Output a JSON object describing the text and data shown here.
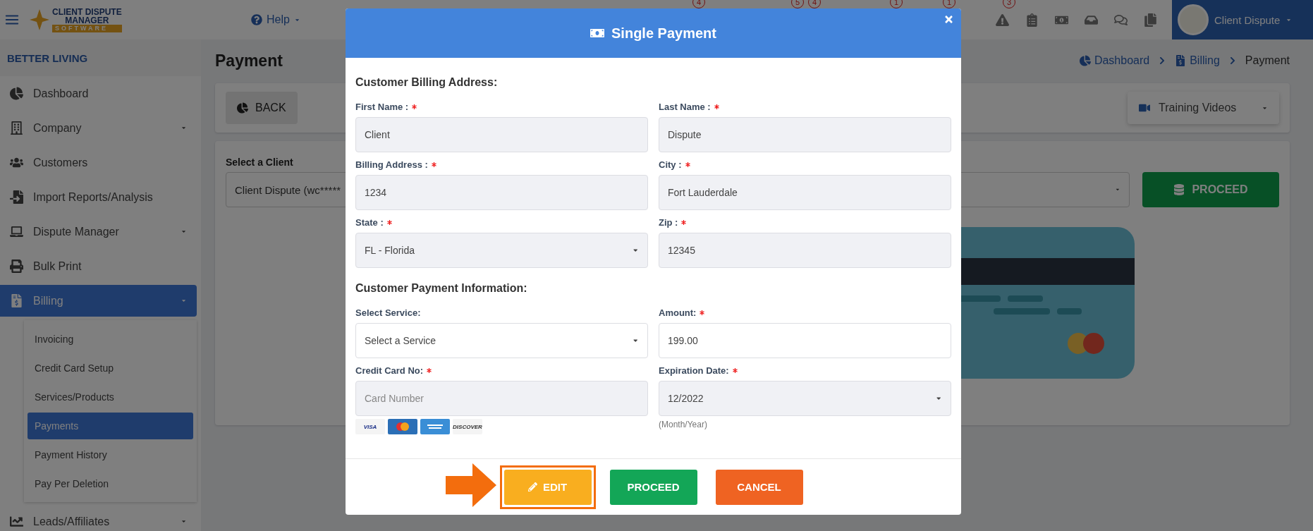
{
  "topbar": {
    "logo": {
      "line1": "CLIENT DISPUTE",
      "line2": "MANAGER",
      "line3": "SOFTWARE"
    },
    "help": "Help",
    "badges_hidden": [
      {
        "badge": "4"
      },
      {
        "badge": "5"
      },
      {
        "badge": "4"
      },
      {
        "badge": "1"
      },
      {
        "badge": "1"
      }
    ],
    "icons": [
      {
        "kind": "warning",
        "badge": "3"
      },
      {
        "kind": "clipboard"
      },
      {
        "kind": "money"
      },
      {
        "kind": "inbox"
      },
      {
        "kind": "comments"
      },
      {
        "kind": "copy"
      }
    ],
    "user": "Client Dispute"
  },
  "sidebar": {
    "company": "BETTER LIVING",
    "items": [
      {
        "label": "Dashboard",
        "kind": "dashboard",
        "selected": false,
        "has_submenu": false
      },
      {
        "label": "Company",
        "kind": "company",
        "selected": false,
        "has_submenu": true
      },
      {
        "label": "Customers",
        "kind": "customers",
        "selected": false,
        "has_submenu": false
      },
      {
        "label": "Import Reports/Analysis",
        "kind": "import",
        "selected": false,
        "has_submenu": false
      },
      {
        "label": "Dispute Manager",
        "kind": "laptop",
        "selected": false,
        "has_submenu": true
      },
      {
        "label": "Bulk Print",
        "kind": "print",
        "selected": false,
        "has_submenu": false
      },
      {
        "label": "Billing",
        "kind": "billing",
        "selected": true,
        "has_submenu": true,
        "children": [
          {
            "label": "Invoicing",
            "selected": false
          },
          {
            "label": "Credit Card Setup",
            "selected": false
          },
          {
            "label": "Services/Products",
            "selected": false
          },
          {
            "label": "Payments",
            "selected": true
          },
          {
            "label": "Payment History",
            "selected": false
          },
          {
            "label": "Pay Per Deletion",
            "selected": false
          }
        ]
      },
      {
        "label": "Leads/Affiliates",
        "kind": "leads",
        "selected": false,
        "has_submenu": true
      }
    ]
  },
  "page": {
    "title": "Payment",
    "breadcrumb": [
      {
        "label": "Dashboard",
        "kind": "dashboard"
      },
      {
        "label": "Billing",
        "kind": "billing"
      },
      {
        "label": "Payment",
        "kind": "current"
      }
    ],
    "back": "BACK",
    "training": "Training Videos",
    "client_label": "Select a Client",
    "client_value": "Client Dispute (wc*****",
    "proceed": "PROCEED"
  },
  "modal": {
    "title": "Single Payment",
    "sections": [
      {
        "title": "Customer Billing Address:",
        "fields": [
          {
            "label": "First Name :",
            "required": true,
            "kind": "input",
            "readonly": true,
            "value": "Client"
          },
          {
            "label": "Last Name :",
            "required": true,
            "kind": "input",
            "readonly": true,
            "value": "Dispute"
          },
          {
            "label": "Billing Address :",
            "required": true,
            "kind": "input",
            "readonly": true,
            "value": "1234"
          },
          {
            "label": "City :",
            "required": true,
            "kind": "input",
            "readonly": true,
            "value": "Fort Lauderdale"
          },
          {
            "label": "State :",
            "required": true,
            "kind": "select",
            "readonly": true,
            "value": "FL - Florida"
          },
          {
            "label": "Zip :",
            "required": true,
            "kind": "input",
            "readonly": true,
            "value": "12345"
          }
        ]
      },
      {
        "title": "Customer Payment Information:",
        "fields": [
          {
            "label": "Select Service:",
            "required": false,
            "kind": "select",
            "readonly": false,
            "value": "Select a Service"
          },
          {
            "label": "Amount:",
            "required": true,
            "kind": "input",
            "readonly": false,
            "value": "199.00"
          },
          {
            "label": "Credit Card No:",
            "required": true,
            "kind": "input",
            "readonly": true,
            "placeholder": "Card Number",
            "brands": [
              {
                "kind": "visa",
                "text": "VISA"
              },
              {
                "kind": "mastercard"
              },
              {
                "kind": "amex"
              },
              {
                "kind": "discover",
                "text": "DISCOVER"
              }
            ]
          },
          {
            "label": "Expiration Date:",
            "required": true,
            "kind": "select",
            "readonly": true,
            "value": "12/2022",
            "hint": "(Month/Year)"
          }
        ]
      }
    ],
    "buttons": [
      {
        "label": "EDIT",
        "kind": "edit",
        "highlighted": true
      },
      {
        "label": "PROCEED",
        "kind": "proceed",
        "highlighted": false
      },
      {
        "label": "CANCEL",
        "kind": "cancel",
        "highlighted": false
      }
    ]
  }
}
